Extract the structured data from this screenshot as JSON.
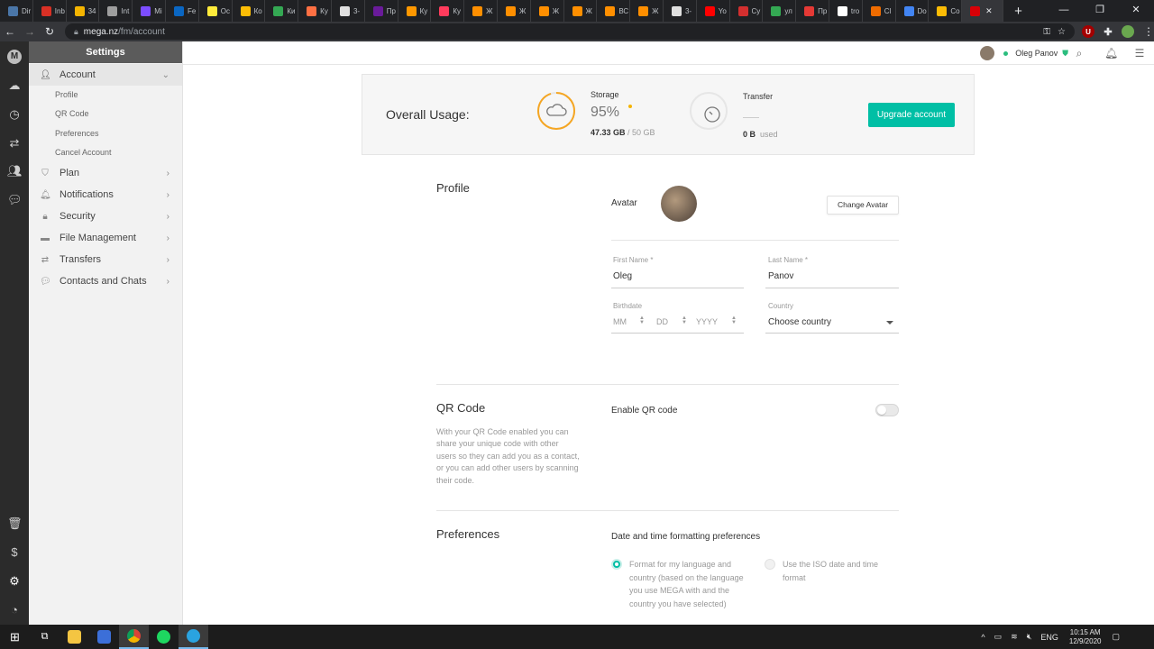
{
  "browser": {
    "tabs": [
      {
        "title": "Dir",
        "color": "#4a76a8"
      },
      {
        "title": "Inb",
        "color": "#d93025"
      },
      {
        "title": "34",
        "color": "#f4b400"
      },
      {
        "title": "Int",
        "color": "#9e9e9e"
      },
      {
        "title": "Mi",
        "color": "#7c4dff"
      },
      {
        "title": "Fe",
        "color": "#0a66c2"
      },
      {
        "title": "Oc",
        "color": "#ffeb3b"
      },
      {
        "title": "Ко",
        "color": "#fbbc05"
      },
      {
        "title": "Ки",
        "color": "#34a853"
      },
      {
        "title": "Ку",
        "color": "#ff7043"
      },
      {
        "title": "3-",
        "color": "#e0e0e0"
      },
      {
        "title": "Пр",
        "color": "#6a1b9a"
      },
      {
        "title": "Ку",
        "color": "#ff9800"
      },
      {
        "title": "Ку",
        "color": "#ff3b5c"
      },
      {
        "title": "Ж",
        "color": "#ff8f00"
      },
      {
        "title": "Ж",
        "color": "#ff8f00"
      },
      {
        "title": "Ж",
        "color": "#ff8f00"
      },
      {
        "title": "Ж",
        "color": "#ff8f00"
      },
      {
        "title": "ВС",
        "color": "#ff8f00"
      },
      {
        "title": "Ж",
        "color": "#ff8f00"
      },
      {
        "title": "3-",
        "color": "#e0e0e0"
      },
      {
        "title": "Yo",
        "color": "#ff0000"
      },
      {
        "title": "Су",
        "color": "#d32f2f"
      },
      {
        "title": "ул",
        "color": "#34a853"
      },
      {
        "title": "Пр",
        "color": "#e53935"
      },
      {
        "title": "tro",
        "color": "#ffffff"
      },
      {
        "title": "Cl",
        "color": "#ef6c00"
      },
      {
        "title": "Do",
        "color": "#4285f4"
      },
      {
        "title": "Co",
        "color": "#fbbc05"
      }
    ],
    "active_tab_color": "#d90007",
    "url_host": "mega.nz",
    "url_path": "/fm/account"
  },
  "sidebar": {
    "header": "Settings",
    "items": [
      {
        "label": "Account",
        "icon": "user-icon"
      },
      {
        "label": "Plan",
        "icon": "shield-icon"
      },
      {
        "label": "Notifications",
        "icon": "bell-icon"
      },
      {
        "label": "Security",
        "icon": "lock-icon"
      },
      {
        "label": "File Management",
        "icon": "folder-icon"
      },
      {
        "label": "Transfers",
        "icon": "transfer-icon"
      },
      {
        "label": "Contacts and Chats",
        "icon": "chat-icon"
      }
    ],
    "account_sub": [
      "Profile",
      "QR Code",
      "Preferences",
      "Cancel Account"
    ]
  },
  "topbar": {
    "user_name": "Oleg Panov"
  },
  "usage": {
    "title": "Overall Usage:",
    "storage_label": "Storage",
    "storage_percent": "95%",
    "storage_fraction": 0.95,
    "storage_used": "47.33 GB",
    "storage_total": "/ 50 GB",
    "transfer_label": "Transfer",
    "transfer_used": "0 B",
    "transfer_used_suffix": "used",
    "upgrade_label": "Upgrade account",
    "accent": "#f5a623",
    "brand": "#00bfa5"
  },
  "profile": {
    "title": "Profile",
    "avatar_label": "Avatar",
    "change_avatar": "Change Avatar",
    "first_name_label": "First Name *",
    "first_name": "Oleg",
    "last_name_label": "Last Name *",
    "last_name": "Panov",
    "birthdate_label": "Birthdate",
    "mm": "MM",
    "dd": "DD",
    "yyyy": "YYYY",
    "country_label": "Country",
    "country_value": "Choose country"
  },
  "qr": {
    "title": "QR Code",
    "enable_label": "Enable QR code",
    "enabled": false,
    "description": "With your QR Code enabled you can share your unique code with other users so they can add you as a contact, or you can add other users by scanning their code."
  },
  "preferences": {
    "title": "Preferences",
    "subtitle": "Date and time formatting preferences",
    "option1": "Format for my language and country (based on the language you use MEGA with and the country you have selected)",
    "option2": "Use the ISO date and time format",
    "selected": "option1"
  },
  "taskbar": {
    "lang": "ENG",
    "time": "10:15 AM",
    "date": "12/9/2020"
  }
}
